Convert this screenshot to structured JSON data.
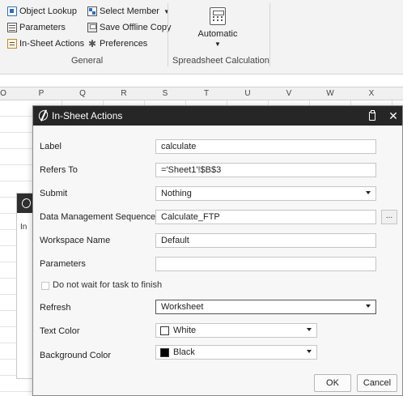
{
  "ribbon": {
    "general": {
      "object_lookup": "Object Lookup",
      "parameters": "Parameters",
      "in_sheet_actions": "In-Sheet Actions",
      "select_member": "Select Member",
      "save_offline_copy": "Save Offline Copy",
      "preferences": "Preferences",
      "group_label": "General"
    },
    "calculation": {
      "mode": "Automatic",
      "group_label": "Spreadsheet Calculation"
    }
  },
  "sheet": {
    "columns": [
      "O",
      "P",
      "Q",
      "R",
      "S",
      "T",
      "U",
      "V",
      "W",
      "X"
    ],
    "background_panel_tab": "In"
  },
  "dialog": {
    "title": "In-Sheet Actions",
    "fields": {
      "label": {
        "label": "Label",
        "value": "calculate"
      },
      "refers_to": {
        "label": "Refers To",
        "value": "='Sheet1'!$B$3"
      },
      "submit": {
        "label": "Submit",
        "value": "Nothing"
      },
      "data_management_sequence": {
        "label": "Data Management Sequence",
        "value": "Calculate_FTP",
        "browse": "..."
      },
      "workspace_name": {
        "label": "Workspace Name",
        "value": "Default"
      },
      "parameters": {
        "label": "Parameters",
        "value": ""
      },
      "no_wait": {
        "label": "Do not wait for task to finish"
      },
      "refresh": {
        "label": "Refresh",
        "value": "Worksheet"
      },
      "text_color": {
        "label": "Text Color",
        "value": "White",
        "swatch": "#ffffff"
      },
      "background_color": {
        "label": "Background Color",
        "value": "Black",
        "swatch": "#000000"
      }
    },
    "buttons": {
      "ok": "OK",
      "cancel": "Cancel"
    }
  },
  "colors": {
    "titlebar": "#262626",
    "ribbon_bg": "#f3f3f3"
  }
}
